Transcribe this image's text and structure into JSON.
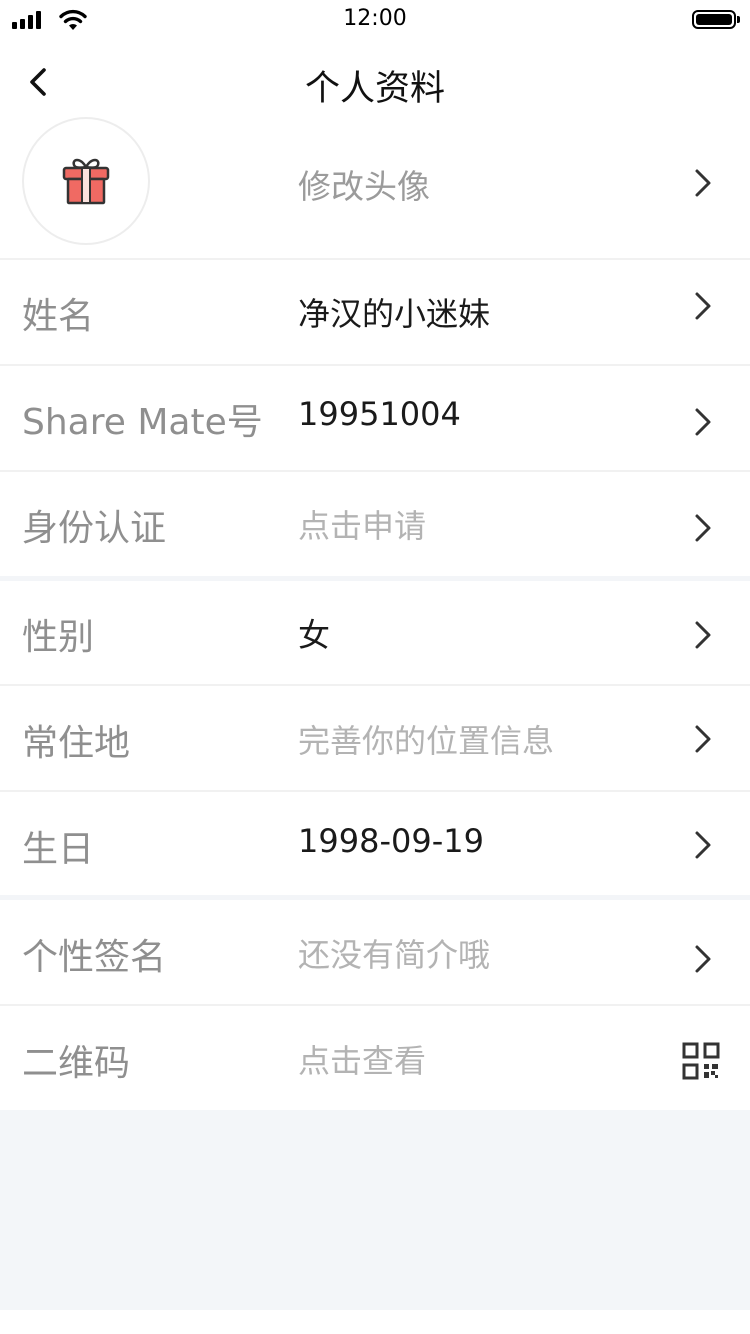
{
  "status_bar": {
    "time": "12:00"
  },
  "nav": {
    "title": "个人资料"
  },
  "avatar_row": {
    "value": "修改头像"
  },
  "rows": [
    {
      "label": "姓名",
      "value": "净汉的小迷妹"
    },
    {
      "label": "Share Mate号",
      "value": "19951004"
    },
    {
      "label": "身份认证",
      "value": "点击申请"
    },
    {
      "label": "性别",
      "value": "女"
    },
    {
      "label": "常住地",
      "value": "完善你的位置信息"
    },
    {
      "label": "生日",
      "value": "1998-09-19"
    },
    {
      "label": "个性签名",
      "value": "还没有简介哦"
    },
    {
      "label": "二维码",
      "value": "点击查看"
    }
  ],
  "icons": {
    "back": "chevron-left-icon",
    "row_arrow": "chevron-right-icon",
    "avatar": "gift-icon",
    "qr": "qr-code-icon"
  },
  "colors": {
    "gift_red": "#f06a63",
    "footer_bg": "#f3f6f9"
  }
}
